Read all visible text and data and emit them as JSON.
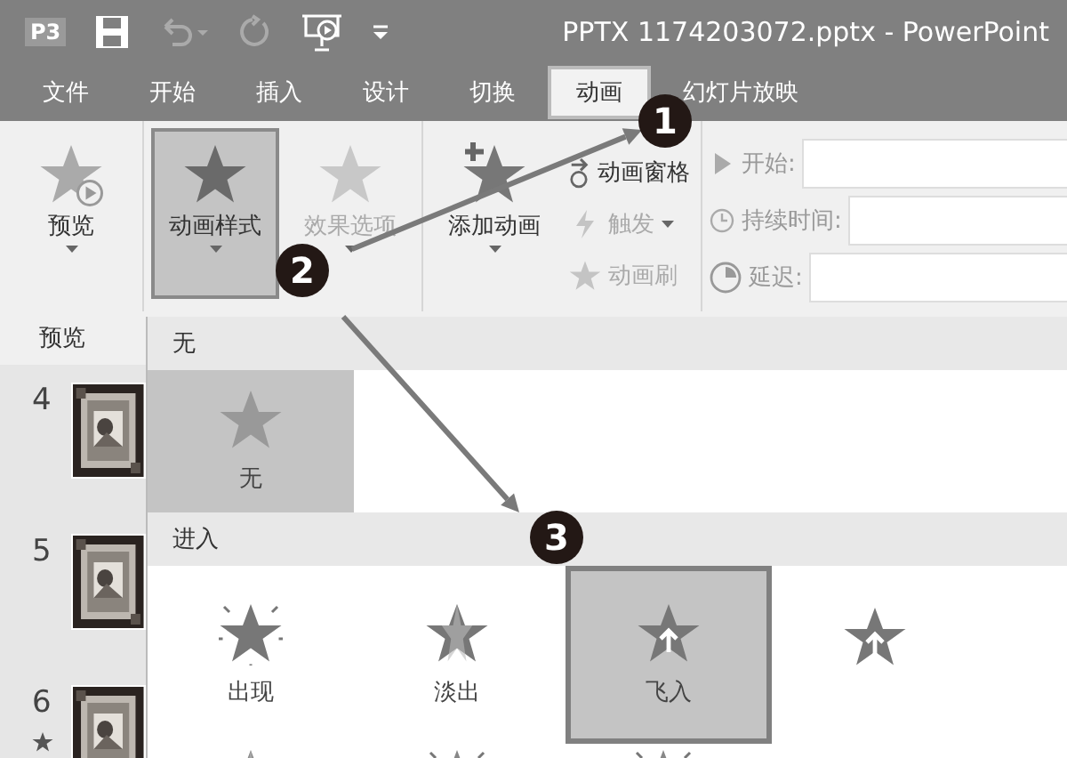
{
  "title_bar": {
    "app_badge": "P3",
    "title": "PPTX 1174203072.pptx - PowerPoint"
  },
  "tabs": [
    {
      "label": "文件",
      "selected": false
    },
    {
      "label": "开始",
      "selected": false
    },
    {
      "label": "插入",
      "selected": false
    },
    {
      "label": "设计",
      "selected": false
    },
    {
      "label": "切换",
      "selected": false
    },
    {
      "label": "动画",
      "selected": true
    },
    {
      "label": "幻灯片放映",
      "selected": false
    }
  ],
  "ribbon": {
    "groups": [
      {
        "buttons": [
          {
            "label": "预览",
            "kind": "preview",
            "selected": false,
            "disabled": false
          }
        ],
        "label": "预览"
      },
      {
        "buttons": [
          {
            "label": "动画样式",
            "kind": "style",
            "selected": true,
            "disabled": false
          },
          {
            "label": "效果选项",
            "kind": "style",
            "selected": false,
            "disabled": true
          }
        ]
      },
      {
        "buttons": [
          {
            "label": "添加动画",
            "kind": "add",
            "selected": false,
            "disabled": false
          }
        ],
        "small": [
          {
            "label": "动画窗格",
            "kind": "pane",
            "disabled": false,
            "dropdown": false
          },
          {
            "label": "触发",
            "kind": "trigger",
            "disabled": true,
            "dropdown": true
          },
          {
            "label": "动画刷",
            "kind": "painter",
            "disabled": true,
            "dropdown": false
          }
        ]
      },
      {
        "fields": [
          {
            "label": "开始:",
            "kind": "start"
          },
          {
            "label": "持续时间:",
            "kind": "duration"
          },
          {
            "label": "延迟:",
            "kind": "delay"
          }
        ]
      }
    ]
  },
  "slides": [
    {
      "number": "4",
      "animated": false
    },
    {
      "number": "5",
      "animated": false
    },
    {
      "number": "6",
      "animated": true
    }
  ],
  "gallery": {
    "sections": [
      {
        "title": "无",
        "items": [
          {
            "label": "无",
            "kind": "none",
            "selected": true
          }
        ]
      },
      {
        "title": "进入",
        "items": [
          {
            "label": "出现",
            "kind": "appear",
            "selected": false
          },
          {
            "label": "淡出",
            "kind": "fade",
            "selected": false
          },
          {
            "label": "飞入",
            "kind": "fly",
            "selected": true
          },
          {
            "kind": "float",
            "selected": false
          }
        ]
      }
    ],
    "partial_row": [
      {
        "kind": "fade"
      },
      {
        "kind": "appear"
      },
      {
        "kind": "appear"
      }
    ]
  },
  "callouts": [
    {
      "label": "1"
    },
    {
      "label": "2"
    },
    {
      "label": "3"
    }
  ]
}
